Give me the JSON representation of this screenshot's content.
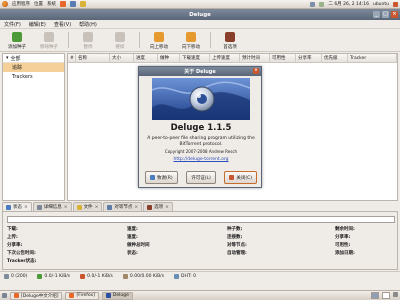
{
  "top_panel": {
    "menus": [
      "应用程序",
      "位置",
      "系统"
    ],
    "clock": "二 6月 26, 2 14:16",
    "user": "ubuntu"
  },
  "window": {
    "title": "Deluge"
  },
  "menubar": [
    "文件(F)",
    "编辑(E)",
    "查看(V)",
    "帮助(H)"
  ],
  "toolbar": {
    "add": "添加种子",
    "remove": "移除种子",
    "pause": "暂停",
    "resume": "继续",
    "up": "向上移动",
    "down": "向下移动",
    "prefs": "首选项"
  },
  "sidebar": {
    "header": "全部",
    "items": [
      "追踪",
      "Trackers"
    ]
  },
  "torrent_columns": [
    "#",
    "名称",
    "大小",
    "进度",
    "做种",
    "下载速度",
    "上传速度",
    "预计时间",
    "可用性",
    "分享率",
    "优先级",
    "Tracker"
  ],
  "tabs": [
    "状态",
    "详细信息",
    "文件",
    "对等节点",
    "选项"
  ],
  "details": {
    "progress_percent": 0,
    "rows": [
      [
        [
          "下载:",
          ""
        ],
        [
          "速度:",
          ""
        ],
        [
          "种子数:",
          ""
        ],
        [
          "剩余时间:",
          ""
        ]
      ],
      [
        [
          "上传:",
          ""
        ],
        [
          "速度:",
          ""
        ],
        [
          "连接数:",
          ""
        ],
        [
          "分享率:",
          ""
        ]
      ],
      [
        [
          "分享率:",
          ""
        ],
        [
          "做种总时间",
          ""
        ],
        [
          "对等节点:",
          ""
        ],
        [
          "可用性:",
          ""
        ]
      ],
      [
        [
          "下次公告时间:",
          ""
        ],
        [
          "状态:",
          ""
        ],
        [
          "自动管理:",
          ""
        ],
        [
          "添加日期:",
          ""
        ]
      ],
      [
        [
          "Tracker状态:",
          ""
        ]
      ]
    ]
  },
  "statusbar": [
    "0 (200)",
    "0.0/-1 KiB/s",
    "0.0/-1 KiB/s",
    "0.00/0.00 KiB/s",
    "DHT: 0"
  ],
  "taskbar": {
    "tasks": [
      "[Deluge中文介绍]",
      "[Firefox]",
      "Deluge"
    ],
    "active_index": 2
  },
  "about_dialog": {
    "title": "关于 Deluge",
    "app_name": "Deluge 1.1.5",
    "description": "A peer-to-peer file sharing program utilizing the BitTorrent protocol.",
    "copyright": "Copyright 2007-2008 Andrew Resch",
    "website": "http://deluge-torrent.org",
    "buttons": {
      "credits": "致谢(R)",
      "license": "许可证(L)",
      "close": "关闭(C)"
    }
  },
  "colors": {
    "titlebar": "#5a6677",
    "selection": "#f5d199",
    "logo_blue": "#2a4fa0",
    "close_accent": "#c9562e"
  }
}
